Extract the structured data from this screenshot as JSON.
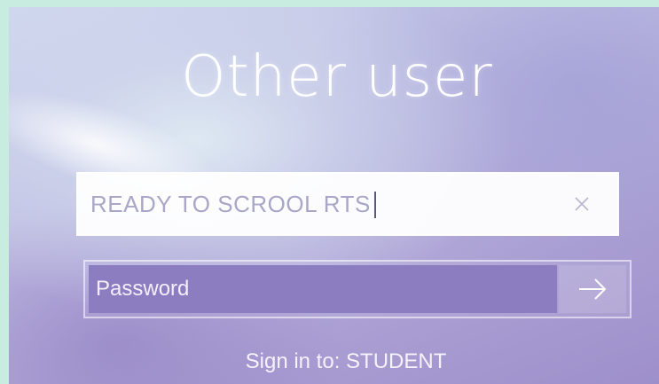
{
  "login": {
    "title": "Other user",
    "username": {
      "value": "READY TO SCROOL RTS",
      "clear_icon": "close-icon"
    },
    "password": {
      "placeholder": "Password",
      "submit_icon": "arrow-right-icon"
    },
    "sign_in_to": "Sign in to: STUDENT"
  },
  "colors": {
    "page_border": "#c9ece0",
    "password_fill": "#8c7cc0",
    "text": "#ffffff"
  }
}
